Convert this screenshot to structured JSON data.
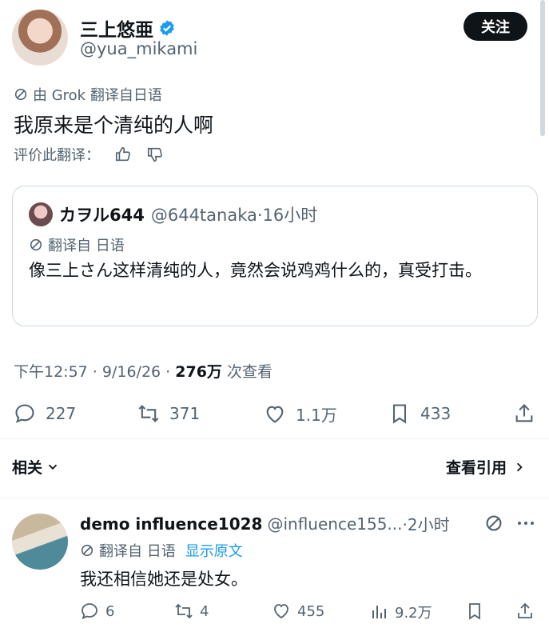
{
  "author": {
    "name": "三上悠亜",
    "handle": "@yua_mikami",
    "follow_label": "关注"
  },
  "tweet": {
    "translation_label": "由 Grok 翻译自日语",
    "text": "我原来是个清纯的人啊",
    "rate_label": "评价此翻译："
  },
  "quote": {
    "name": "カヲル644",
    "handle": "@644tanaka",
    "time": "·16小时",
    "translation_label": "翻译自 日语",
    "text": "像三上さん这样清纯的人，竟然会说鸡鸡什么的，真受打击。"
  },
  "meta": {
    "time": "下午12:57 · 9/16/26 · ",
    "views_count": "276万",
    "views_label": " 次查看"
  },
  "actions": {
    "replies": "227",
    "reposts": "371",
    "likes": "1.1万",
    "bookmarks": "433"
  },
  "related": {
    "label": "相关",
    "quotes_link": "查看引用"
  },
  "reply": {
    "name": "demo influence1028",
    "handle": "@influence155...",
    "time": "·2小时",
    "translation_label": "翻译自 日语",
    "show_original": "显示原文",
    "text": "我还相信她还是处女。",
    "replies": "6",
    "reposts": "4",
    "likes": "455",
    "views": "9.2万"
  },
  "colors": {
    "accent": "#1d9bf0",
    "muted": "#536471",
    "text": "#0f1419"
  }
}
